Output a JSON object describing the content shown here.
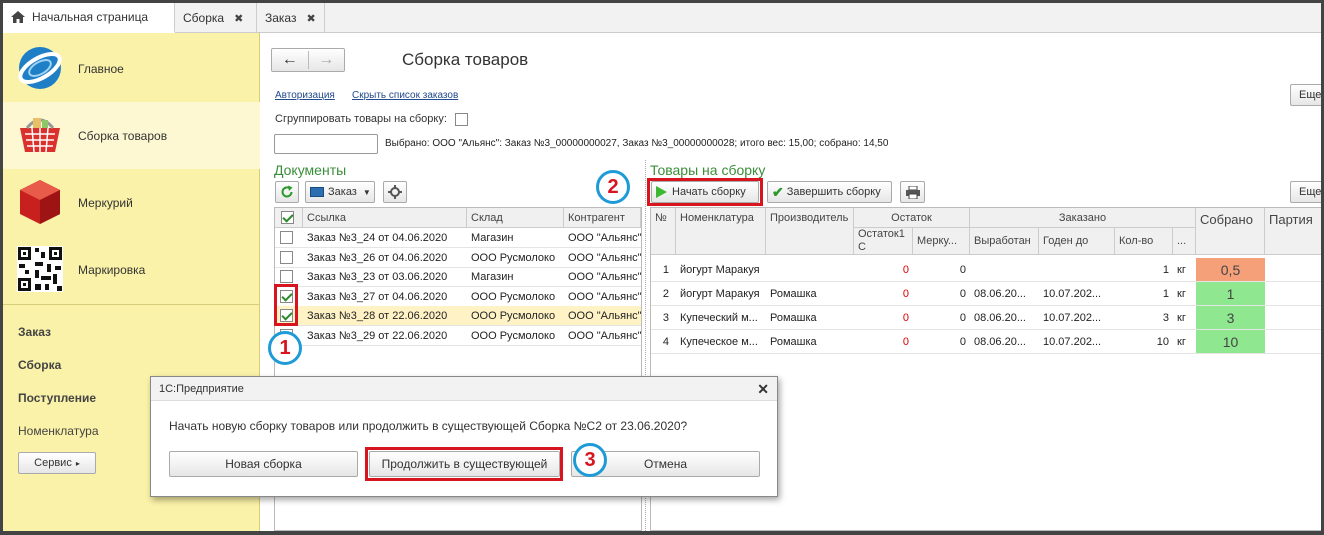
{
  "tabs": [
    {
      "label": "Начальная страница"
    },
    {
      "label": "Сборка"
    },
    {
      "label": "Заказ"
    }
  ],
  "sidebar": {
    "sections": [
      {
        "label": "Главное"
      },
      {
        "label": "Сборка товаров"
      },
      {
        "label": "Меркурий"
      },
      {
        "label": "Маркировка"
      }
    ],
    "links": [
      "Заказ",
      "Сборка",
      "Поступление",
      "Номенклатура"
    ],
    "service_button": "Сервис"
  },
  "page": {
    "title": "Сборка товаров",
    "auth_link": "Авторизация",
    "hide_orders_link": "Скрыть список  заказов",
    "group_label": "Сгруппировать товары на сборку:",
    "selected_text": "Выбрано:  ООО \"Альянс\": Заказ №3_00000000027, Заказ №3_00000000028; итого вес: 15,00; собрано: 14,50",
    "more_label": "Еще"
  },
  "documents": {
    "header": "Документы",
    "order_button": "Заказ",
    "columns": [
      "Ссылка",
      "Склад",
      "Контрагент"
    ],
    "rows": [
      {
        "checked": false,
        "link": "Заказ №3_24 от 04.06.2020",
        "warehouse": "Магазин",
        "counterparty": "ООО \"Альянс\"",
        "selected": false
      },
      {
        "checked": false,
        "link": "Заказ №3_26 от 04.06.2020",
        "warehouse": "ООО Русмолоко",
        "counterparty": "ООО \"Альянс\"",
        "selected": false
      },
      {
        "checked": false,
        "link": "Заказ №3_23 от 03.06.2020",
        "warehouse": "Магазин",
        "counterparty": "ООО \"Альянс\"",
        "selected": false
      },
      {
        "checked": true,
        "link": "Заказ №3_27 от 04.06.2020",
        "warehouse": "ООО Русмолоко",
        "counterparty": "ООО \"Альянс\"",
        "selected": false
      },
      {
        "checked": true,
        "link": "Заказ №3_28 от 22.06.2020",
        "warehouse": "ООО Русмолоко",
        "counterparty": "ООО \"Альянс\"",
        "selected": true
      },
      {
        "checked": false,
        "link": "Заказ №3_29 от 22.06.2020",
        "warehouse": "ООО Русмолоко",
        "counterparty": "ООО \"Альянс\"",
        "selected": false
      }
    ]
  },
  "goods": {
    "header": "Товары на сборку",
    "start_button": "Начать  сборку",
    "finish_button": "Завершить  сборку",
    "columns": {
      "num": "№",
      "nomenclature": "Номенклатура",
      "producer": "Производитель",
      "stock": "Остаток",
      "stock1c_a": "Остаток1",
      "stock1c_b": "С",
      "mercury": "Мерку...",
      "ordered": "Заказано",
      "produced": "Выработан",
      "valid_until": "Годен до",
      "qty": "Кол-во",
      "ellipsis": "...",
      "collected": "Собрано",
      "batch": "Партия"
    },
    "rows": [
      {
        "n": "1",
        "name": "йогурт Маракуя",
        "producer": "",
        "stock1c": "0",
        "mercury": "0",
        "produced": "",
        "valid": "",
        "qty": "1",
        "unit": "кг",
        "collected": "0,5",
        "color": "#f6a07a"
      },
      {
        "n": "2",
        "name": "йогурт Маракуя",
        "producer": "Ромашка",
        "stock1c": "0",
        "mercury": "0",
        "produced": "08.06.20...",
        "valid": "10.07.202...",
        "qty": "1",
        "unit": "кг",
        "collected": "1",
        "color": "#8fe88f"
      },
      {
        "n": "3",
        "name": "Купеческий м...",
        "producer": "Ромашка",
        "stock1c": "0",
        "mercury": "0",
        "produced": "08.06.20...",
        "valid": "10.07.202...",
        "qty": "3",
        "unit": "кг",
        "collected": "3",
        "color": "#8fe88f"
      },
      {
        "n": "4",
        "name": "Купеческое м...",
        "producer": "Ромашка",
        "stock1c": "0",
        "mercury": "0",
        "produced": "08.06.20...",
        "valid": "10.07.202...",
        "qty": "10",
        "unit": "кг",
        "collected": "10",
        "color": "#8fe88f"
      }
    ]
  },
  "dialog": {
    "title": "1С:Предприятие",
    "message": "Начать новую сборку товаров или продолжить в существующей Сборка №С2 от 23.06.2020?",
    "new_button": "Новая сборка",
    "continue_button": "Продолжить в существующей",
    "cancel_button": "Отмена"
  },
  "annotations": [
    "1",
    "2",
    "3"
  ],
  "colors": {
    "accent_red": "#d8141e",
    "circle_blue": "#1e9bd7",
    "sidebar": "#faf2a8",
    "header_green": "#3a8e3a"
  }
}
